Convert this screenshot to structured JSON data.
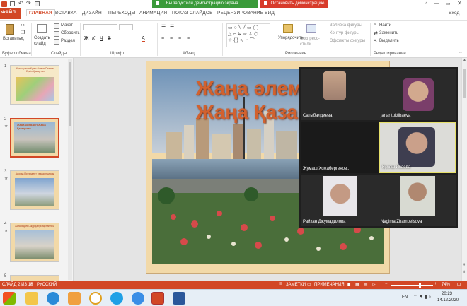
{
  "banner": {
    "sharing_text": "Вы запустили демонстрацию экрана",
    "stop_label": "Остановить демонстрацию"
  },
  "ribbon_tabs": [
    "ФАЙЛ",
    "ГЛАВНАЯ",
    "ВСТАВКА",
    "ДИЗАЙН",
    "ПЕРЕХОДЫ",
    "АНИМАЦИЯ",
    "ПОКАЗ СЛАЙДОВ",
    "РЕЦЕНЗИРОВАНИЕ",
    "ВИД"
  ],
  "signin_label": "Вход",
  "ribbon": {
    "paste_label": "Вставить",
    "create_slide_label": "Создать слайд",
    "layout_label": "Макет",
    "reset_label": "Сбросить",
    "section_label": "Раздел",
    "arrange_label": "Упорядочить",
    "quick_styles_label": "Экспресс-стили",
    "shape_fill_label": "Заливка фигуры",
    "shape_outline_label": "Контур фигуры",
    "shape_effects_label": "Эффекты фигуры",
    "find_label": "Найти",
    "replace_label": "Заменить",
    "select_label": "Выделить",
    "groups": {
      "clipboard": "Буфер обмена",
      "slides": "Слайды",
      "font": "Шрифт",
      "paragraph": "Абзац",
      "drawing": "Рисование",
      "editing": "Редактирование"
    }
  },
  "thumbnails": [
    {
      "num": "1",
      "title": "Күн шуағын Күміс болып Отаным Еркін Қазақстан"
    },
    {
      "num": "2",
      "title": "Жаңа әлемдегі Жаңа Қазақстан"
    },
    {
      "num": "3",
      "title": "Ақорда Президент резиденциясы"
    },
    {
      "num": "4",
      "title": "Астанадағы Ақорда Қазақстанның"
    },
    {
      "num": "5",
      "title": ""
    }
  ],
  "slide": {
    "title_line1": "Жаңа әлемд",
    "title_line2": "Жаңа Қазақ"
  },
  "participants": [
    {
      "name": "Сатыбалдиева"
    },
    {
      "name": "janar tuktibaeva"
    },
    {
      "name": "Жумаш Хожабергенов..."
    },
    {
      "name": "Куляш Исаева"
    },
    {
      "name": "Райхан Джумадилова"
    },
    {
      "name": "Nagima Zhampeisova"
    }
  ],
  "status": {
    "slide_counter": "СЛАЙД 2 ИЗ 15",
    "language": "РУССКИЙ",
    "notes_label": "ЗАМЕТКИ",
    "comments_label": "ПРИМЕЧАНИЯ",
    "zoom": "74%"
  },
  "taskbar": {
    "lang": "EN",
    "time": "20:23",
    "date": "14.12.2020"
  },
  "colors": {
    "accent": "#d24726",
    "banner_green": "#3a9a3a",
    "banner_red": "#d83b2b"
  }
}
